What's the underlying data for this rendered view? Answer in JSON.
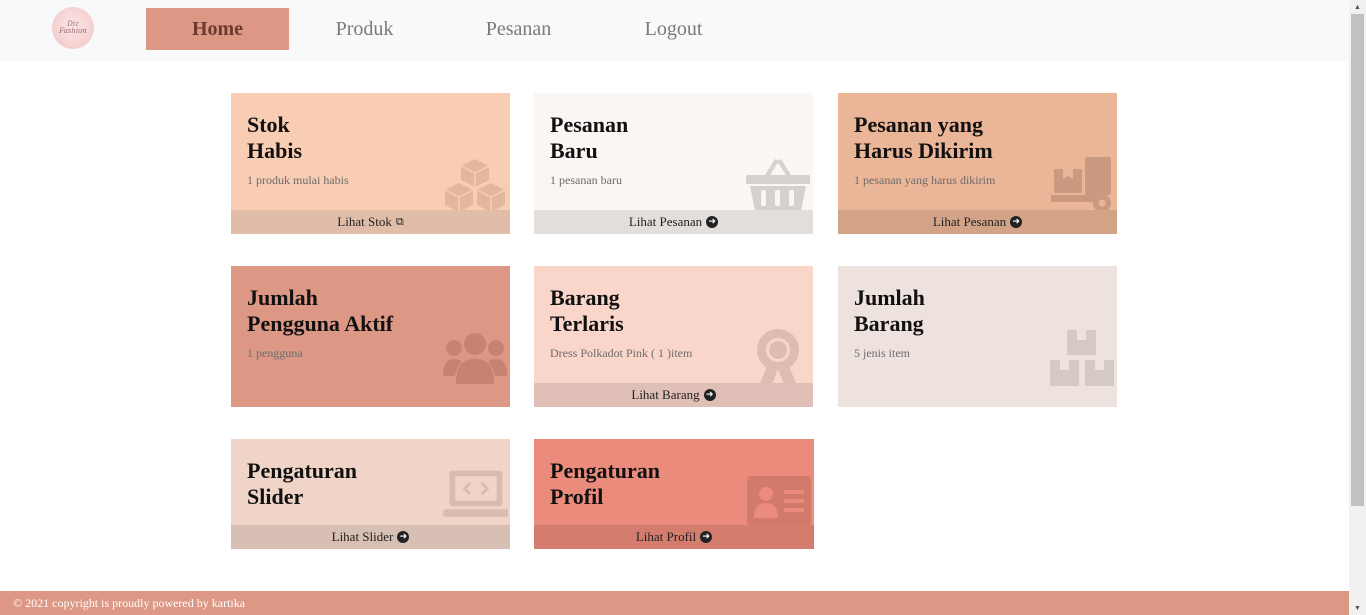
{
  "navbar": {
    "logo_text": "Diz\nFashion",
    "items": [
      {
        "label": "Home",
        "active": true
      },
      {
        "label": "Produk",
        "active": false
      },
      {
        "label": "Pesanan",
        "active": false
      },
      {
        "label": "Logout",
        "active": false
      }
    ]
  },
  "cards": [
    {
      "title": "Stok\nHabis",
      "subtitle": "1 produk mulai habis",
      "footer": "Lihat Stok",
      "icon": "boxes-icon",
      "bg": "#f8cdb3",
      "footer_bg": "#e1bca8"
    },
    {
      "title": "Pesanan\nBaru",
      "subtitle": "1 pesanan baru",
      "footer": "Lihat Pesanan",
      "icon": "basket-icon",
      "bg": "#faf6f4",
      "footer_bg": "#e2dedc"
    },
    {
      "title": "Pesanan yang\nHarus Dikirim",
      "subtitle": "1 pesanan yang harus dikirim",
      "footer": "Lihat Pesanan",
      "icon": "dolly-icon",
      "bg": "#ebb597",
      "footer_bg": "#d3a388"
    },
    {
      "title": "Jumlah\nPengguna Aktif",
      "subtitle": "1 pengguna",
      "footer": "",
      "icon": "users-icon",
      "bg": "#dd9785",
      "footer_bg": ""
    },
    {
      "title": "Barang\nTerlaris",
      "subtitle": "Dress Polkadot Pink ( 1 )item",
      "footer": "Lihat Barang",
      "icon": "award-icon",
      "bg": "#f9d5ca",
      "footer_bg": "#e0c0b6"
    },
    {
      "title": "Jumlah\nBarang",
      "subtitle": "5 jenis item",
      "footer": "",
      "icon": "cubes-icon",
      "bg": "#ede2de",
      "footer_bg": ""
    },
    {
      "title": "Pengaturan\nSlider",
      "subtitle": "",
      "footer": "Lihat Slider",
      "icon": "laptop-code-icon",
      "bg": "#efd4c7",
      "footer_bg": "#d8bfb3"
    },
    {
      "title": "Pengaturan\nProfil",
      "subtitle": "",
      "footer": "Lihat Profil",
      "icon": "id-card-icon",
      "bg": "#ea8b7b",
      "footer_bg": "#d47d6f"
    }
  ],
  "footer": {
    "text": "© 2021 copyright is proudly powered by kartika"
  }
}
